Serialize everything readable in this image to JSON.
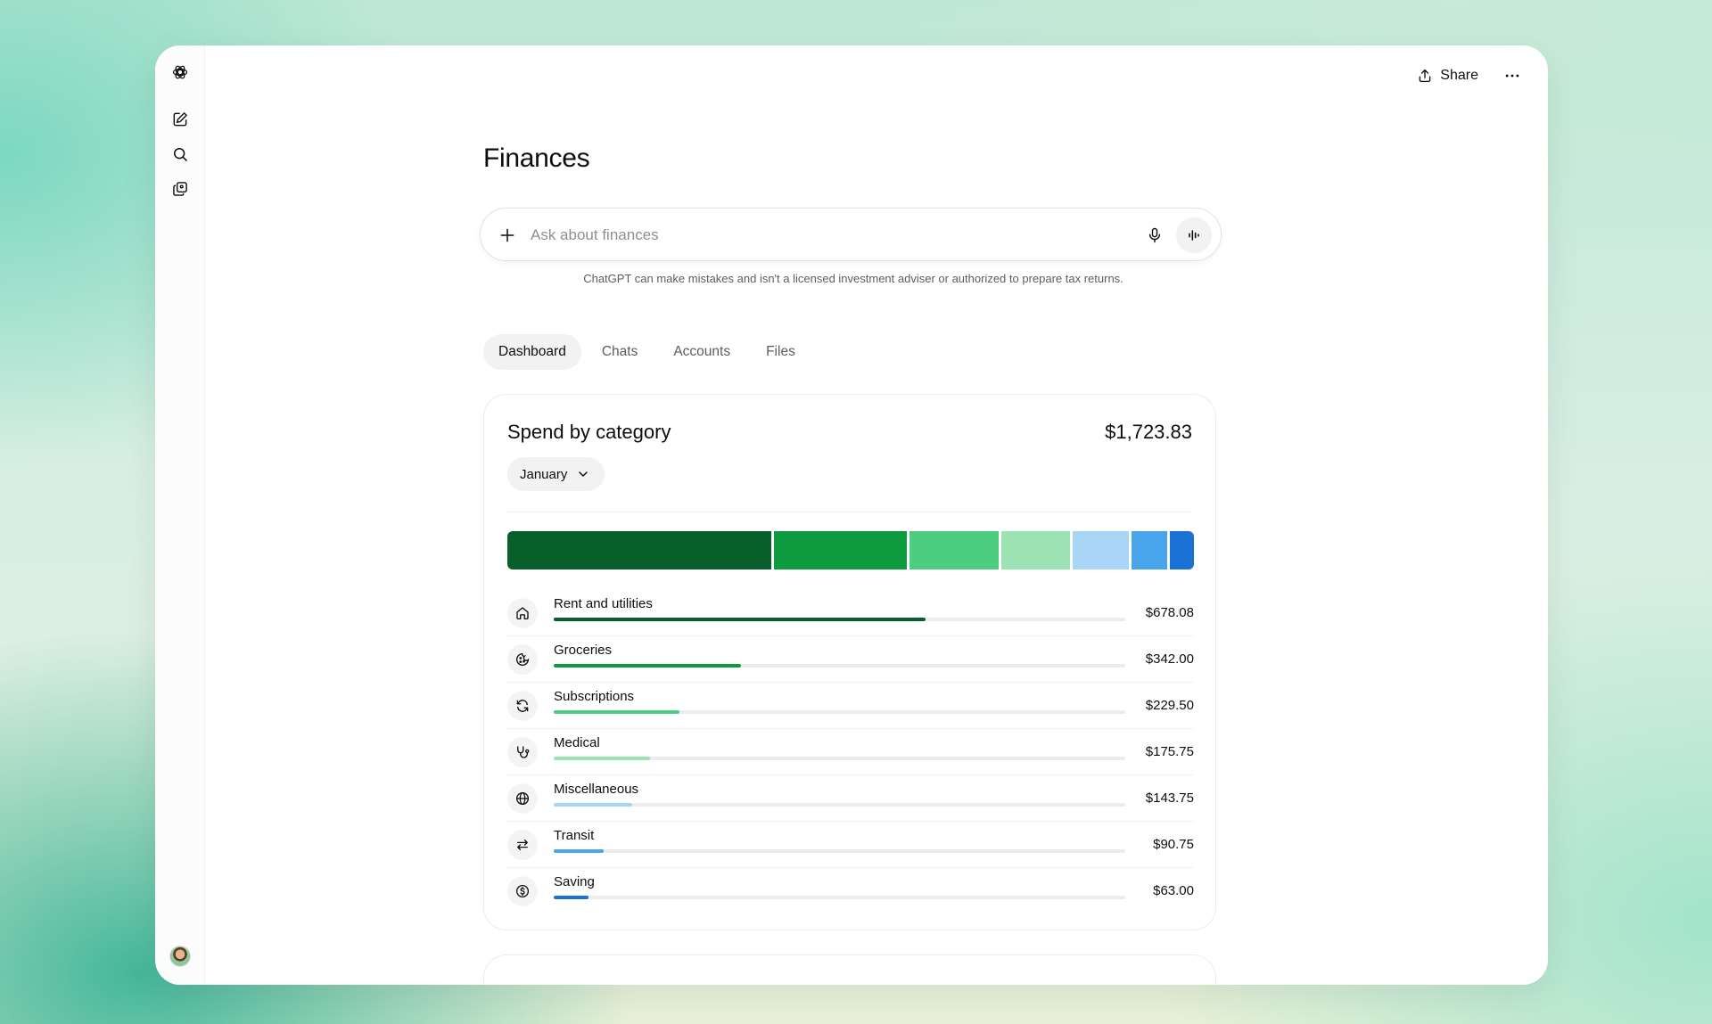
{
  "header": {
    "share_label": "Share"
  },
  "page": {
    "title": "Finances"
  },
  "search": {
    "placeholder": "Ask about finances",
    "disclaimer": "ChatGPT can make mistakes and isn't a licensed investment adviser or authorized to prepare tax returns."
  },
  "tabs": [
    {
      "label": "Dashboard",
      "active": true
    },
    {
      "label": "Chats",
      "active": false
    },
    {
      "label": "Accounts",
      "active": false
    },
    {
      "label": "Files",
      "active": false
    }
  ],
  "spend_card": {
    "title": "Spend by category",
    "total": "$1,723.83",
    "month": "January",
    "categories": [
      {
        "label": "Rent and utilities",
        "amount": "$678.08",
        "value": 678.08,
        "color": "#07602a",
        "icon": "home-icon"
      },
      {
        "label": "Groceries",
        "amount": "$342.00",
        "value": 342.0,
        "color": "#0e9a3f",
        "icon": "cookie-icon"
      },
      {
        "label": "Subscriptions",
        "amount": "$229.50",
        "value": 229.5,
        "color": "#4ccd7f",
        "icon": "refresh-icon"
      },
      {
        "label": "Medical",
        "amount": "$175.75",
        "value": 175.75,
        "color": "#9ce3b4",
        "icon": "stethoscope-icon"
      },
      {
        "label": "Miscellaneous",
        "amount": "$143.75",
        "value": 143.75,
        "color": "#a9d5f7",
        "icon": "globe-icon"
      },
      {
        "label": "Transit",
        "amount": "$90.75",
        "value": 90.75,
        "color": "#4aa6ec",
        "icon": "transfer-icon"
      },
      {
        "label": "Saving",
        "amount": "$63.00",
        "value": 63.0,
        "color": "#1a72d6",
        "icon": "dollar-circle-icon"
      }
    ]
  }
}
